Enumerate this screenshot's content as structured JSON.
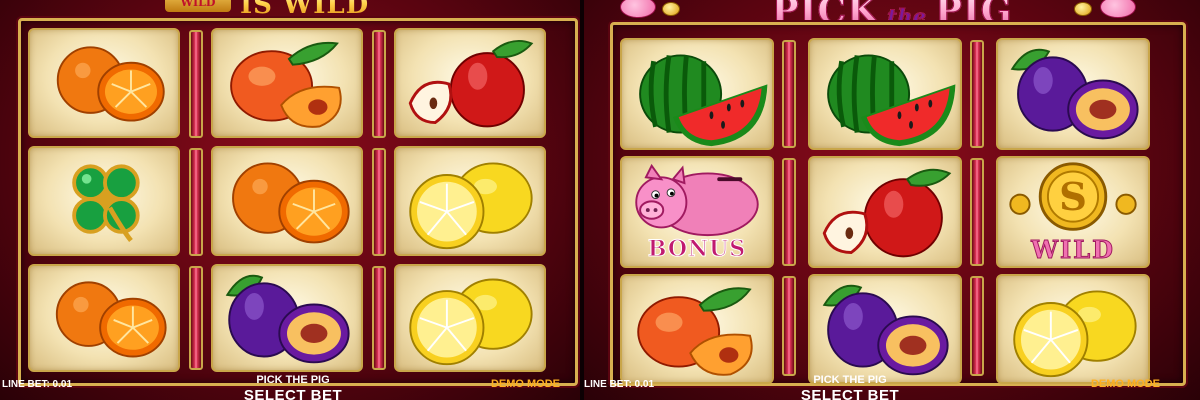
{
  "left_panel": {
    "header_badge": "WILD",
    "header_text": "IS WILD",
    "reels": [
      [
        "orange",
        "clover",
        "orange"
      ],
      [
        "peach",
        "orange",
        "plum"
      ],
      [
        "apple",
        "lemon",
        "lemon"
      ]
    ],
    "line_bet_label": "LINE BET: 0.01",
    "game_name": "PICK THE PIG",
    "select_bet_label": "SELECT BET",
    "demo_mode_label": "DEMO MODE"
  },
  "right_panel": {
    "title_part1": "PICK",
    "title_the": "the",
    "title_part2": "PIG",
    "reels": [
      [
        "watermelon",
        "pig-bonus",
        "peach"
      ],
      [
        "watermelon",
        "apple",
        "plum"
      ],
      [
        "plum",
        "wild-coin",
        "lemon"
      ]
    ],
    "bonus_text": "BONUS",
    "wild_text": "WILD",
    "line_bet_label": "LINE BET: 0.01",
    "game_name": "PICK THE PIG",
    "select_bet_label": "SELECT BET",
    "demo_mode_label": "DEMO MODE"
  },
  "colors": {
    "background": "#5a0410",
    "frame_gold": "#d8b050",
    "separator_pink": "#e2365a",
    "demo_orange": "#ffb020"
  }
}
